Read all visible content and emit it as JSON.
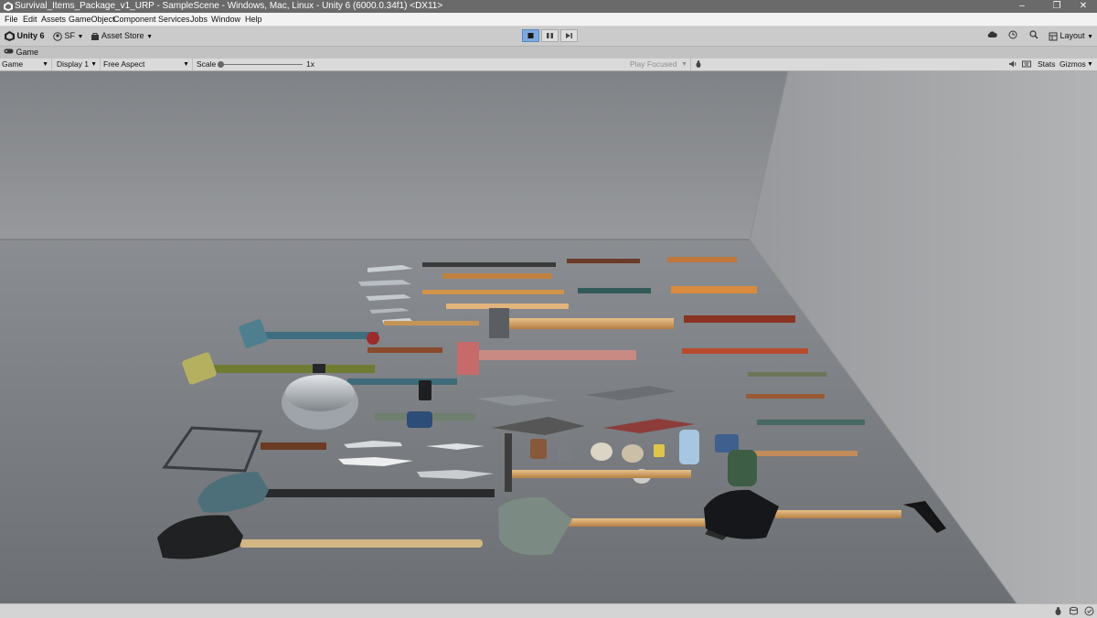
{
  "window": {
    "title": "Survival_Items_Package_v1_URP - SampleScene - Windows, Mac, Linux - Unity 6 (6000.0.34f1) <DX11>",
    "controls": [
      "minimize-icon",
      "restore-icon",
      "close-icon"
    ]
  },
  "menu": [
    "File",
    "Edit",
    "Assets",
    "GameObject",
    "Component",
    "Services",
    "Jobs",
    "Window",
    "Help"
  ],
  "toolbar": {
    "unity_label": "Unity 6",
    "account_label": "SF",
    "asset_store_label": "Asset Store",
    "layout_label": "Layout",
    "play_icons": [
      "stop-icon",
      "pause-icon",
      "step-icon"
    ],
    "right_icons": [
      "cloud-icon",
      "history-icon",
      "search-icon"
    ]
  },
  "tab": {
    "label": "Game"
  },
  "game_toolbar": {
    "mode": "Game",
    "display": "Display 1",
    "aspect": "Free Aspect",
    "scale_label": "Scale",
    "scale_value": "1x",
    "play_mode": "Play Focused",
    "stats_label": "Stats",
    "gizmos_label": "Gizmos"
  },
  "colors": {
    "title_bar": "#6a6a6a",
    "toolbar": "#cbcbcb",
    "play_active": "#7ea9de",
    "floor": "#7c7f84",
    "back_wall": "#909397",
    "right_wall": "#a7a8ab"
  }
}
